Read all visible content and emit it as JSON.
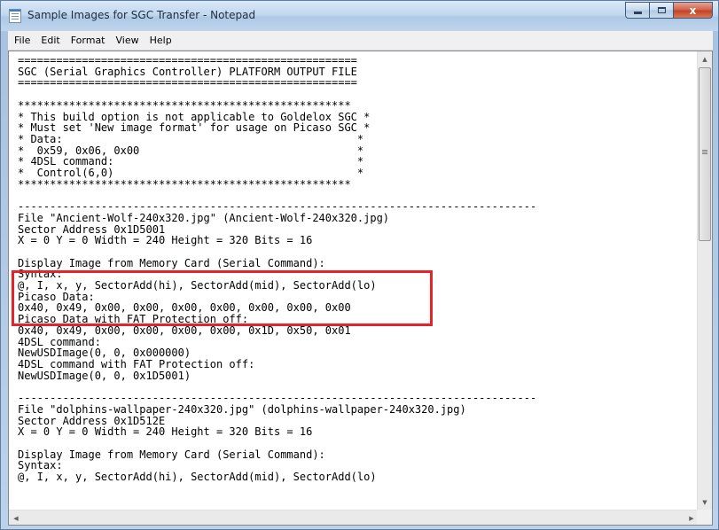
{
  "window": {
    "title": "Sample Images for SGC Transfer - Notepad"
  },
  "caption_buttons": {
    "close_label": "x"
  },
  "menu": {
    "items": [
      {
        "label": "File"
      },
      {
        "label": "Edit"
      },
      {
        "label": "Format"
      },
      {
        "label": "View"
      },
      {
        "label": "Help"
      }
    ]
  },
  "document": {
    "content": "=====================================================\nSGC (Serial Graphics Controller) PLATFORM OUTPUT FILE\n=====================================================\n\n****************************************************\n* This build option is not applicable to Goldelox SGC *\n* Must set 'New image format' for usage on Picaso SGC *\n* Data:                                              *\n*  0x59, 0x06, 0x00                                  *\n* 4DSL command:                                      *\n*  Control(6,0)                                      *\n****************************************************\n\n---------------------------------------------------------------------------------\nFile \"Ancient-Wolf-240x320.jpg\" (Ancient-Wolf-240x320.jpg)\nSector Address 0x1D5001\nX = 0 Y = 0 Width = 240 Height = 320 Bits = 16\n\nDisplay Image from Memory Card (Serial Command):\nSyntax:\n@, I, x, y, SectorAdd(hi), SectorAdd(mid), SectorAdd(lo)\nPicaso Data:\n0x40, 0x49, 0x00, 0x00, 0x00, 0x00, 0x00, 0x00, 0x00\nPicaso Data with FAT Protection off:\n0x40, 0x49, 0x00, 0x00, 0x00, 0x00, 0x1D, 0x50, 0x01\n4DSL command:\nNewUSDImage(0, 0, 0x000000)\n4DSL command with FAT Protection off:\nNewUSDImage(0, 0, 0x1D5001)\n\n---------------------------------------------------------------------------------\nFile \"dolphins-wallpaper-240x320.jpg\" (dolphins-wallpaper-240x320.jpg)\nSector Address 0x1D512E\nX = 0 Y = 0 Width = 240 Height = 320 Bits = 16\n\nDisplay Image from Memory Card (Serial Command):\nSyntax:\n@, I, x, y, SectorAdd(hi), SectorAdd(mid), SectorAdd(lo)"
  }
}
